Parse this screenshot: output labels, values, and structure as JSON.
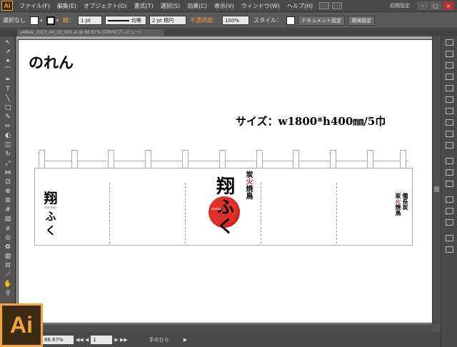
{
  "app": {
    "logo": "Ai",
    "badge": "Ai",
    "workspace": "初期設定"
  },
  "menu": [
    "ファイル(F)",
    "編集(E)",
    "オブジェクト(O)",
    "書式(T)",
    "選択(S)",
    "効果(C)",
    "表示(V)",
    "ウィンドウ(W)",
    "ヘルプ(H)"
  ],
  "control": {
    "selection": "選択なし",
    "stroke_label": "線：",
    "stroke_weight": "1 pt",
    "stroke_profile": "均等",
    "brush": "2 pt 楕円",
    "opacity_label": "不透明度：",
    "opacity": "100%",
    "style_label": "スタイル：",
    "doc_setup": "ドキュメント設定",
    "prefs": "環境設定"
  },
  "document": {
    "tab": "yellow_2013_04_15_001.ai @ 66.67% (CMYK/プレビュー)"
  },
  "artboard": {
    "title": "のれん",
    "size_text": "サイズ：w1800*h400㎜/5巾",
    "left_logo": {
      "kanji": "翔",
      "kana": "ふく",
      "romaji": "sho-fuku"
    },
    "center_logo": {
      "kanji": "翔",
      "kana": "ふく",
      "romaji": "shofuku",
      "sub_1": "炭",
      "sub_red": "火",
      "sub_2": "焼鳥"
    },
    "right_logo": {
      "col1": "備長炭",
      "col2a": "炭",
      "col2red": "火",
      "col2b": "焼鳥"
    }
  },
  "status": {
    "zoom": "66.67%",
    "page": "1",
    "tool": "手のひら"
  },
  "colors": {
    "accent": "#f7a23a",
    "red": "#d22222",
    "ui_bg": "#535353"
  }
}
